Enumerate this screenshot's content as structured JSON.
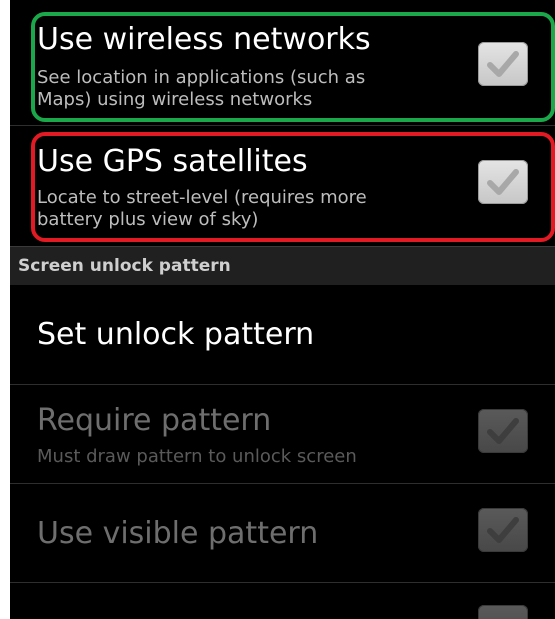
{
  "location_settings": {
    "wireless_networks": {
      "title": "Use wireless networks",
      "summary": "See location in applications (such as\nMaps) using wireless networks",
      "checked": true
    },
    "gps_satellites": {
      "title": "Use GPS satellites",
      "summary": "Locate to street-level (requires more\nbattery plus view of sky)",
      "checked": true
    }
  },
  "screen_unlock": {
    "category_label": "Screen unlock pattern",
    "set_unlock_pattern": {
      "title": "Set unlock pattern"
    },
    "require_pattern": {
      "title": "Require pattern",
      "summary": "Must draw pattern to unlock screen",
      "enabled": false,
      "checked": true
    },
    "use_visible_pattern": {
      "title": "Use visible pattern",
      "enabled": false,
      "checked": true
    }
  },
  "colors": {
    "background": "#000000",
    "highlight_green": "#1aa84a",
    "highlight_red": "#e21a23"
  },
  "icons": {
    "checkbox": "checkmark-icon"
  }
}
